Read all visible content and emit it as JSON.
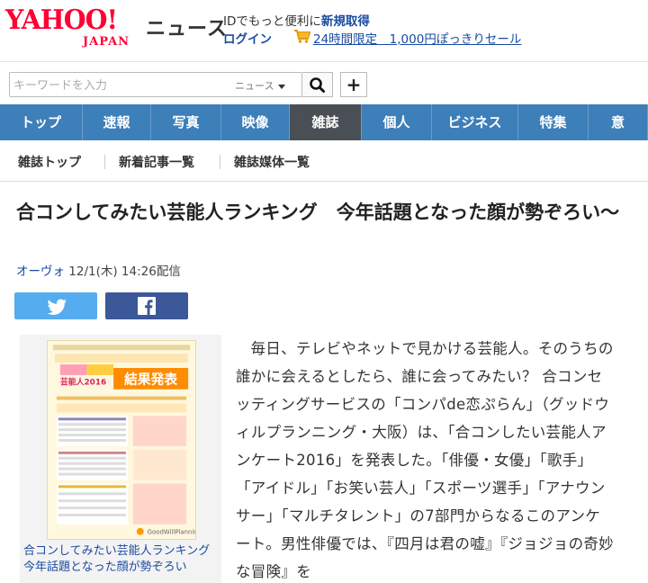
{
  "header": {
    "logo_text": "YAHOO!",
    "logo_sub": "JAPAN",
    "service_name": "ニュース",
    "promo_prefix": "IDでもっと便利に",
    "signup_label": "新規取得",
    "login_label": "ログイン",
    "sale_label": "24時間限定　1,000円ぽっきりセール"
  },
  "search": {
    "placeholder": "キーワードを入力",
    "scope_label": "ニュース",
    "add_label": "+"
  },
  "gnav": {
    "items": [
      "トップ",
      "速報",
      "写真",
      "映像",
      "雑誌",
      "個人",
      "ビジネス",
      "特集",
      "意"
    ],
    "active": "雑誌"
  },
  "subnav": {
    "items": [
      "雑誌トップ",
      "新着記事一覧",
      "雑誌媒体一覧"
    ]
  },
  "article": {
    "title": "合コンしてみたい芸能人ランキング　今年話題となった顔が勢ぞろい〜",
    "source": "オーヴォ",
    "datetime": "12/1(木) 14:26配信",
    "figure_caption": "合コンしてみたい芸能人ランキング　今年話題となった顔が勢ぞろい",
    "body": "毎日、テレビやネットで見かける芸能人。そのうちの誰かに会えるとしたら、誰に会ってみたい？ 合コンセッティングサービスの「コンパde恋ぷらん」（グッドウィルプランニング・大阪）は、「合コンしたい芸能人アンケート2016」を発表した。「俳優・女優」「歌手」「アイドル」「お笑い芸人」「スポーツ選手」「アナウンサー」「マルチタレント」の7部門からなるこのアンケート。男性俳優では、『四月は君の嘘』『ジョジョの奇妙な冒険』を"
  },
  "figure_image": {
    "banner_text": "合コンしたい芸能人2016 結果発表",
    "brand": "GoodWillPlanning"
  },
  "colors": {
    "brand_red": "#ff0033",
    "nav_blue": "#3d7fb9",
    "nav_active": "#4a4e55",
    "link_blue": "#1a4ba1",
    "twitter": "#55acee",
    "facebook": "#3b5998"
  }
}
